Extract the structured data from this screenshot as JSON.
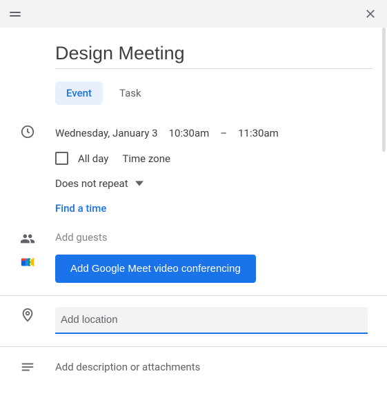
{
  "header": {},
  "title": "Design Meeting",
  "tabs": {
    "event": "Event",
    "task": "Task",
    "active": "event"
  },
  "datetime": {
    "date": "Wednesday, January 3",
    "start": "10:30am",
    "sep": "–",
    "end": "11:30am"
  },
  "allday": {
    "label": "All day",
    "checked": false
  },
  "timezone_label": "Time zone",
  "repeat": {
    "label": "Does not repeat"
  },
  "find_time_label": "Find a time",
  "guests": {
    "placeholder": "Add guests"
  },
  "meet_button": "Add Google Meet video conferencing",
  "location": {
    "placeholder": "Add location",
    "value": ""
  },
  "description_placeholder": "Add description or attachments"
}
